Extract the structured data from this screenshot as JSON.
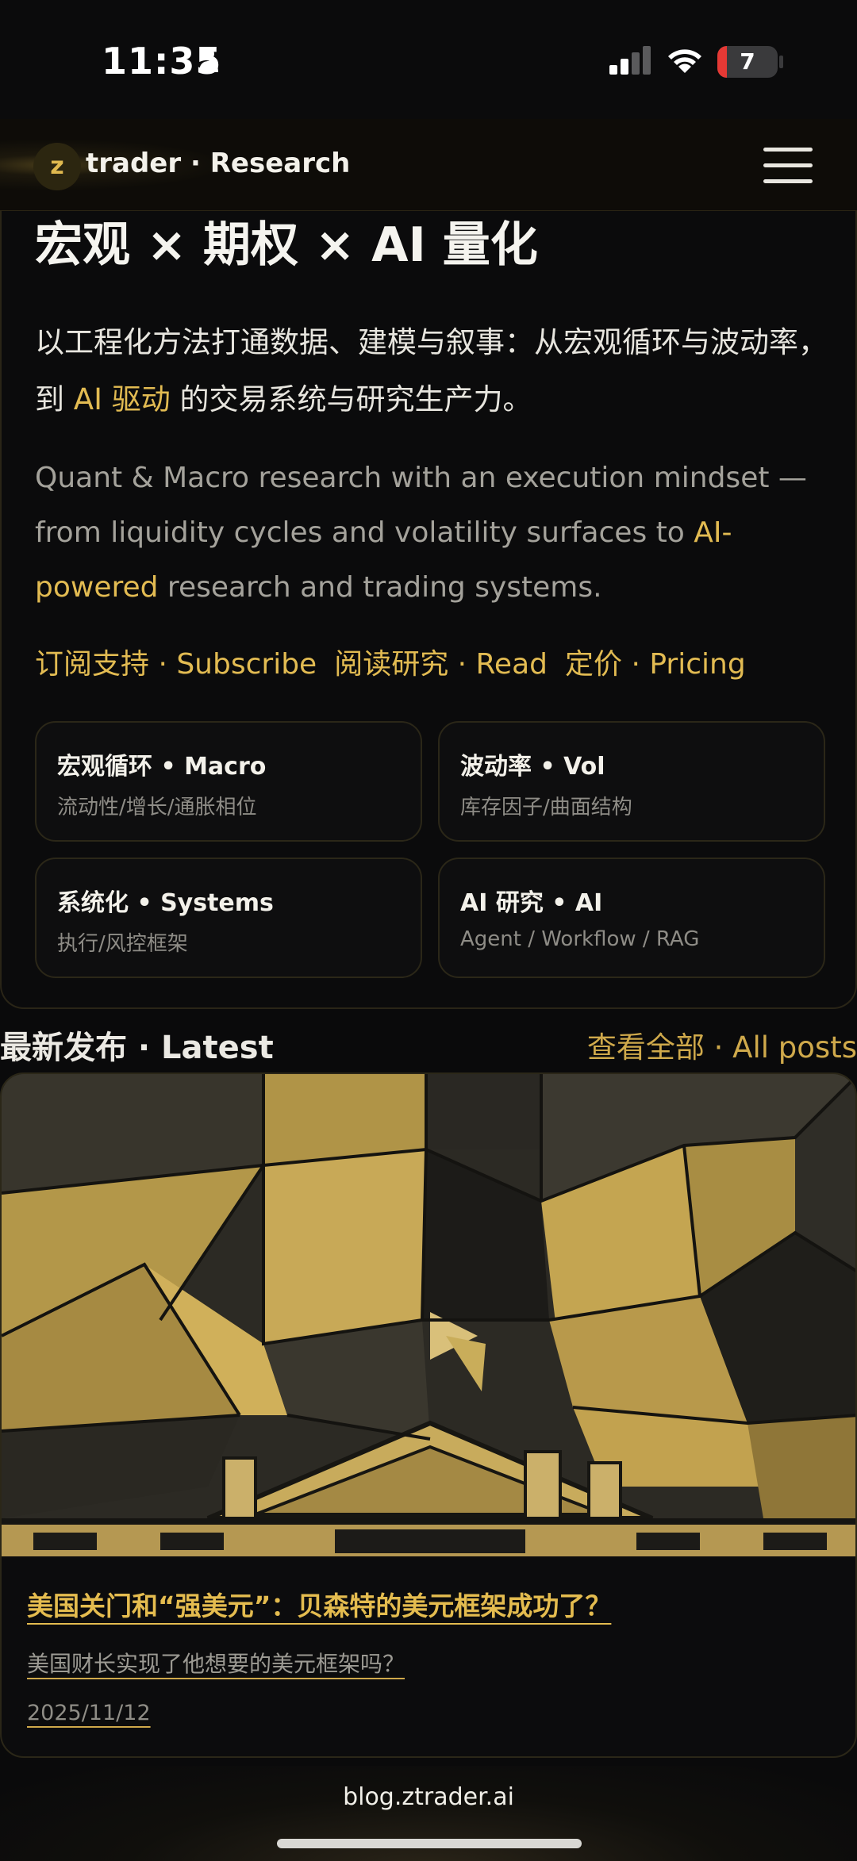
{
  "status_bar": {
    "time": "11:35",
    "battery": "7"
  },
  "header": {
    "logo_letter": "z",
    "brand": "trader · Research"
  },
  "hero": {
    "title": "宏观 × 期权 × AI 量化",
    "zh_part1": "以工程化方法打通数据、建模与叙事：从宏观循环与波动率，到 ",
    "zh_accent": "AI 驱动",
    "zh_part2": " 的交易系统与研究生产力。",
    "en_part1": "Quant & Macro research with an execution mindset — from liquidity cycles and volatility surfaces to ",
    "en_accent": "AI-powered",
    "en_part2": " research and trading systems.",
    "links": [
      "订阅支持 · Subscribe",
      "阅读研究 · Read",
      "定价 · Pricing"
    ],
    "tiles": [
      {
        "title": "宏观循环 • Macro",
        "sub": "流动性/增长/通胀相位"
      },
      {
        "title": "波动率 • Vol",
        "sub": "库存因子/曲面结构"
      },
      {
        "title": "系统化 • Systems",
        "sub": "执行/风控框架"
      },
      {
        "title": "AI 研究 • AI",
        "sub": "Agent / Workflow / RAG"
      }
    ]
  },
  "latest": {
    "heading": "最新发布 · Latest",
    "all_posts": "查看全部 · All posts",
    "post": {
      "title": "美国关门和“强美元”：贝森特的美元框架成功了？",
      "subtitle": "美国财长实现了他想要的美元框架吗？",
      "date": "2025/11/12"
    }
  },
  "browser": {
    "url": "blog.ztrader.ai"
  },
  "colors": {
    "accent": "#e2bb52",
    "background": "#0a0a0b",
    "card_border": "#2b2718"
  }
}
